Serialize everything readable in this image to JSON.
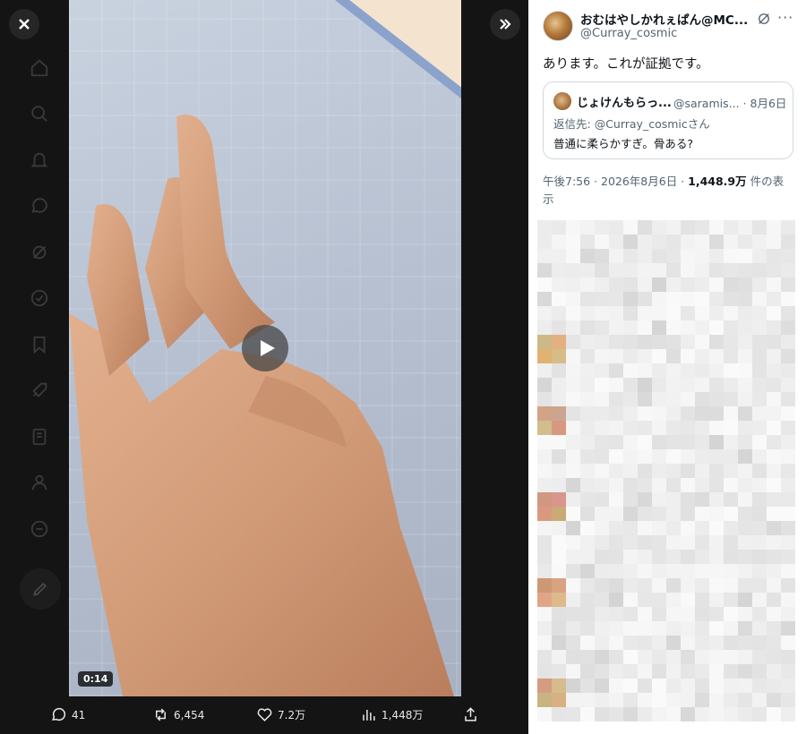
{
  "viewer": {
    "video_time": "0:14"
  },
  "actions": {
    "replies": "41",
    "reposts": "6,454",
    "likes": "7.2万",
    "views": "1,448万"
  },
  "post": {
    "author_name": "おむはやしかれぇぱん@MC...",
    "author_handle": "@Curray_cosmic",
    "text": "あります。これが証拠です。",
    "quote": {
      "author_name": "じょけんもらっ...",
      "author_handle": "@saramis...",
      "date": "· 8月6日",
      "reply_prefix": "返信先: ",
      "reply_mention": "@Curray_cosmic",
      "reply_suffix": "さん",
      "text": "普通に柔らかすぎ。骨ある?"
    },
    "time": "午後7:56",
    "date": "2026年8月6日",
    "views_count": "1,448.9万",
    "views_label": "件の表示"
  },
  "colors": {
    "accent_text": "#0f1419",
    "muted_text": "#536471",
    "dark_bg": "#141414"
  }
}
